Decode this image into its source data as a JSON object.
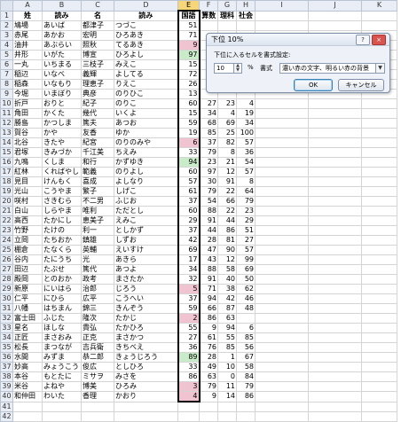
{
  "columns": [
    "",
    "A",
    "B",
    "C",
    "D",
    "E",
    "F",
    "G",
    "H",
    "I",
    "J",
    "K"
  ],
  "selected_column": "E",
  "header_row": {
    "row": "1",
    "cells": [
      "",
      "姓",
      "読み",
      "名",
      "読み",
      "国語",
      "算数",
      "理科",
      "社会",
      "",
      "",
      ""
    ]
  },
  "rows": [
    {
      "row": "2",
      "cells": [
        "",
        "鳩場",
        "あいば",
        "都津子",
        "つづこ",
        "51",
        "",
        "",
        "",
        "",
        "",
        ""
      ],
      "hl": ""
    },
    {
      "row": "3",
      "cells": [
        "",
        "赤尾",
        "あかお",
        "宏明",
        "ひろあき",
        "71",
        "",
        "",
        "",
        "",
        "",
        ""
      ],
      "hl": ""
    },
    {
      "row": "4",
      "cells": [
        "",
        "油井",
        "あぶらい",
        "照秋",
        "てるあき",
        "9",
        "",
        "",
        "",
        "",
        "",
        ""
      ],
      "hl": "pink"
    },
    {
      "row": "5",
      "cells": [
        "",
        "井形",
        "いがた",
        "博宣",
        "ひろよし",
        "97",
        "",
        "",
        "",
        "",
        "",
        ""
      ],
      "hl": "green"
    },
    {
      "row": "6",
      "cells": [
        "",
        "一丸",
        "いちまる",
        "三枝子",
        "みえこ",
        "15",
        "",
        "",
        "",
        "",
        "",
        ""
      ],
      "hl": ""
    },
    {
      "row": "7",
      "cells": [
        "",
        "稲辺",
        "いなべ",
        "義輝",
        "よしてる",
        "72",
        "",
        "",
        "",
        "",
        "",
        ""
      ],
      "hl": ""
    },
    {
      "row": "8",
      "cells": [
        "",
        "稲森",
        "いなもり",
        "理恵子",
        "りえこ",
        "26",
        "",
        "",
        "",
        "",
        "",
        ""
      ],
      "hl": ""
    },
    {
      "row": "9",
      "cells": [
        "",
        "今堀",
        "いまぼり",
        "典彦",
        "のりひこ",
        "13",
        "",
        "",
        "",
        "",
        "",
        ""
      ],
      "hl": ""
    },
    {
      "row": "10",
      "cells": [
        "",
        "折戸",
        "おりと",
        "紀子",
        "のりこ",
        "60",
        "27",
        "23",
        "4",
        "",
        "",
        ""
      ],
      "hl": ""
    },
    {
      "row": "11",
      "cells": [
        "",
        "角田",
        "かくた",
        "幾代",
        "いくよ",
        "15",
        "34",
        "4",
        "19",
        "",
        "",
        ""
      ],
      "hl": ""
    },
    {
      "row": "12",
      "cells": [
        "",
        "勝島",
        "かつしま",
        "篤夫",
        "あつお",
        "59",
        "68",
        "69",
        "34",
        "",
        "",
        ""
      ],
      "hl": ""
    },
    {
      "row": "13",
      "cells": [
        "",
        "賀谷",
        "かや",
        "友香",
        "ゆか",
        "19",
        "85",
        "25",
        "100",
        "",
        "",
        ""
      ],
      "hl": ""
    },
    {
      "row": "14",
      "cells": [
        "",
        "北谷",
        "きたや",
        "紀宮",
        "のりのみや",
        "6",
        "37",
        "82",
        "57",
        "",
        "",
        ""
      ],
      "hl": "pink"
    },
    {
      "row": "15",
      "cells": [
        "",
        "君塚",
        "きみづか",
        "千江美",
        "ちえみ",
        "33",
        "79",
        "8",
        "36",
        "",
        "",
        ""
      ],
      "hl": ""
    },
    {
      "row": "16",
      "cells": [
        "",
        "九鳴",
        "くしま",
        "和行",
        "かずゆき",
        "94",
        "23",
        "21",
        "54",
        "",
        "",
        ""
      ],
      "hl": "green"
    },
    {
      "row": "17",
      "cells": [
        "",
        "紅林",
        "くればやし",
        "範義",
        "のりよし",
        "60",
        "97",
        "12",
        "57",
        "",
        "",
        ""
      ],
      "hl": ""
    },
    {
      "row": "18",
      "cells": [
        "",
        "見目",
        "けんもく",
        "喜成",
        "よしなり",
        "57",
        "30",
        "91",
        "8",
        "",
        "",
        ""
      ],
      "hl": ""
    },
    {
      "row": "19",
      "cells": [
        "",
        "光山",
        "こうやま",
        "繁子",
        "しげこ",
        "61",
        "79",
        "22",
        "64",
        "",
        "",
        ""
      ],
      "hl": ""
    },
    {
      "row": "20",
      "cells": [
        "",
        "咲村",
        "さきむら",
        "不二男",
        "ふじお",
        "37",
        "54",
        "66",
        "79",
        "",
        "",
        ""
      ],
      "hl": ""
    },
    {
      "row": "21",
      "cells": [
        "",
        "白山",
        "しらやま",
        "唯利",
        "ただとし",
        "60",
        "88",
        "22",
        "23",
        "",
        "",
        ""
      ],
      "hl": ""
    },
    {
      "row": "22",
      "cells": [
        "",
        "高西",
        "たかにし",
        "恵美子",
        "えみこ",
        "29",
        "91",
        "44",
        "29",
        "",
        "",
        ""
      ],
      "hl": ""
    },
    {
      "row": "23",
      "cells": [
        "",
        "竹野",
        "たけの",
        "利一",
        "としかず",
        "37",
        "44",
        "86",
        "51",
        "",
        "",
        ""
      ],
      "hl": ""
    },
    {
      "row": "24",
      "cells": [
        "",
        "立岡",
        "たちおか",
        "鎮雄",
        "しずお",
        "42",
        "28",
        "81",
        "27",
        "",
        "",
        ""
      ],
      "hl": ""
    },
    {
      "row": "25",
      "cells": [
        "",
        "棚倉",
        "たなくら",
        "英輔",
        "えいすけ",
        "69",
        "47",
        "90",
        "57",
        "",
        "",
        ""
      ],
      "hl": ""
    },
    {
      "row": "26",
      "cells": [
        "",
        "谷内",
        "たにうち",
        "光",
        "あきら",
        "17",
        "43",
        "12",
        "99",
        "",
        "",
        ""
      ],
      "hl": ""
    },
    {
      "row": "27",
      "cells": [
        "",
        "田辺",
        "たぶせ",
        "篤代",
        "あつよ",
        "34",
        "88",
        "58",
        "69",
        "",
        "",
        ""
      ],
      "hl": ""
    },
    {
      "row": "28",
      "cells": [
        "",
        "殿岡",
        "とのおか",
        "政考",
        "まさたか",
        "32",
        "91",
        "40",
        "50",
        "",
        "",
        ""
      ],
      "hl": ""
    },
    {
      "row": "29",
      "cells": [
        "",
        "新原",
        "にいはら",
        "治郎",
        "じろう",
        "5",
        "71",
        "38",
        "62",
        "",
        "",
        ""
      ],
      "hl": "pink"
    },
    {
      "row": "30",
      "cells": [
        "",
        "仁平",
        "にひら",
        "広平",
        "こうへい",
        "37",
        "94",
        "42",
        "46",
        "",
        "",
        ""
      ],
      "hl": ""
    },
    {
      "row": "31",
      "cells": [
        "",
        "八幡",
        "はちまん",
        "錦三",
        "きんぞう",
        "59",
        "66",
        "87",
        "48",
        "",
        "",
        ""
      ],
      "hl": ""
    },
    {
      "row": "32",
      "cells": [
        "",
        "富士田",
        "ふじた",
        "隆次",
        "たかじ",
        "2",
        "86",
        "63",
        "",
        "",
        "",
        ""
      ],
      "hl": "pink"
    },
    {
      "row": "33",
      "cells": [
        "",
        "星名",
        "ほしな",
        "貴弘",
        "たかひろ",
        "55",
        "9",
        "94",
        "6",
        "",
        "",
        ""
      ],
      "hl": ""
    },
    {
      "row": "34",
      "cells": [
        "",
        "正匠",
        "まさおみ",
        "正克",
        "まさかつ",
        "27",
        "61",
        "55",
        "85",
        "",
        "",
        ""
      ],
      "hl": ""
    },
    {
      "row": "35",
      "cells": [
        "",
        "松長",
        "まつなが",
        "吉兵衛",
        "きちべえ",
        "36",
        "76",
        "85",
        "56",
        "",
        "",
        ""
      ],
      "hl": ""
    },
    {
      "row": "36",
      "cells": [
        "",
        "水間",
        "みずま",
        "恭二郎",
        "きょうじろう",
        "89",
        "28",
        "1",
        "67",
        "",
        "",
        ""
      ],
      "hl": "green"
    },
    {
      "row": "37",
      "cells": [
        "",
        "妙高",
        "みょうこう",
        "俊広",
        "としひろ",
        "33",
        "49",
        "10",
        "58",
        "",
        "",
        ""
      ],
      "hl": ""
    },
    {
      "row": "38",
      "cells": [
        "",
        "本谷",
        "もとたに",
        "ミサヲ",
        "みさを",
        "86",
        "63",
        "0",
        "84",
        "",
        "",
        ""
      ],
      "hl": ""
    },
    {
      "row": "39",
      "cells": [
        "",
        "米谷",
        "よねや",
        "博美",
        "ひろみ",
        "3",
        "79",
        "11",
        "79",
        "",
        "",
        ""
      ],
      "hl": "pink"
    },
    {
      "row": "40",
      "cells": [
        "",
        "和仲田",
        "わいた",
        "香理",
        "かおり",
        "4",
        "9",
        "14",
        "86",
        "",
        "",
        ""
      ],
      "hl": "pink"
    },
    {
      "row": "41",
      "cells": [
        "",
        "",
        "",
        "",
        "",
        "",
        "",
        "",
        "",
        "",
        "",
        ""
      ],
      "hl": ""
    },
    {
      "row": "42",
      "cells": [
        "",
        "",
        "",
        "",
        "",
        "",
        "",
        "",
        "",
        "",
        "",
        ""
      ],
      "hl": ""
    }
  ],
  "dialog": {
    "title": "下位 10%",
    "help": "?",
    "close": "×",
    "prompt": "下位に入るセルを書式設定:",
    "count": "10",
    "spin_up": "▲",
    "spin_down": "▼",
    "unit": "%",
    "format_label": "書式",
    "format_value": "濃い赤の文字、明るい赤の背景",
    "dropdown": "▼",
    "ok": "OK",
    "cancel": "キャンセル"
  }
}
